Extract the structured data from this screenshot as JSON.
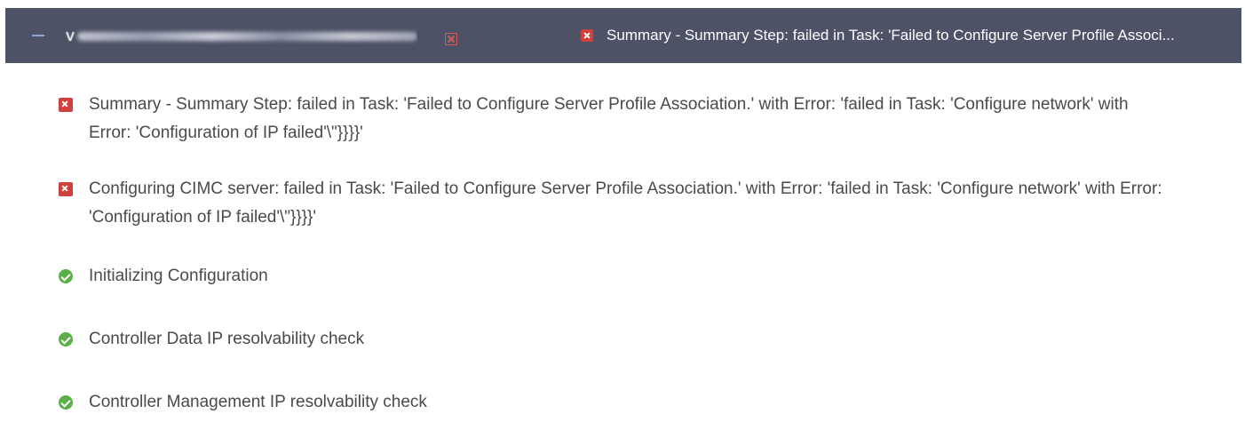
{
  "header": {
    "name_first_char": "V",
    "status_text": "Summary - Summary Step: failed in Task: 'Failed to Configure Server Profile Associ..."
  },
  "items": [
    {
      "status": "error",
      "icon": "error-icon",
      "text": "Summary - Summary Step: failed in Task: 'Failed to Configure Server Profile Association.' with Error: 'failed in Task: 'Configure network' with Error: 'Configuration of IP failed'\\\"}}}}'"
    },
    {
      "status": "error",
      "icon": "error-icon",
      "text": "Configuring CIMC server: failed in Task: 'Failed to Configure Server Profile Association.' with Error: 'failed in Task: 'Configure network' with Error: 'Configuration of IP failed'\\\"}}}}'"
    },
    {
      "status": "success",
      "icon": "check-circle-icon",
      "text": "Initializing Configuration"
    },
    {
      "status": "success",
      "icon": "check-circle-icon",
      "text": "Controller Data IP resolvability check"
    },
    {
      "status": "success",
      "icon": "check-circle-icon",
      "text": "Controller Management IP resolvability check"
    }
  ],
  "colors": {
    "header_bg": "#4d5267",
    "error": "#d0403d",
    "success": "#5aaf48",
    "text": "#4a4a4a"
  }
}
